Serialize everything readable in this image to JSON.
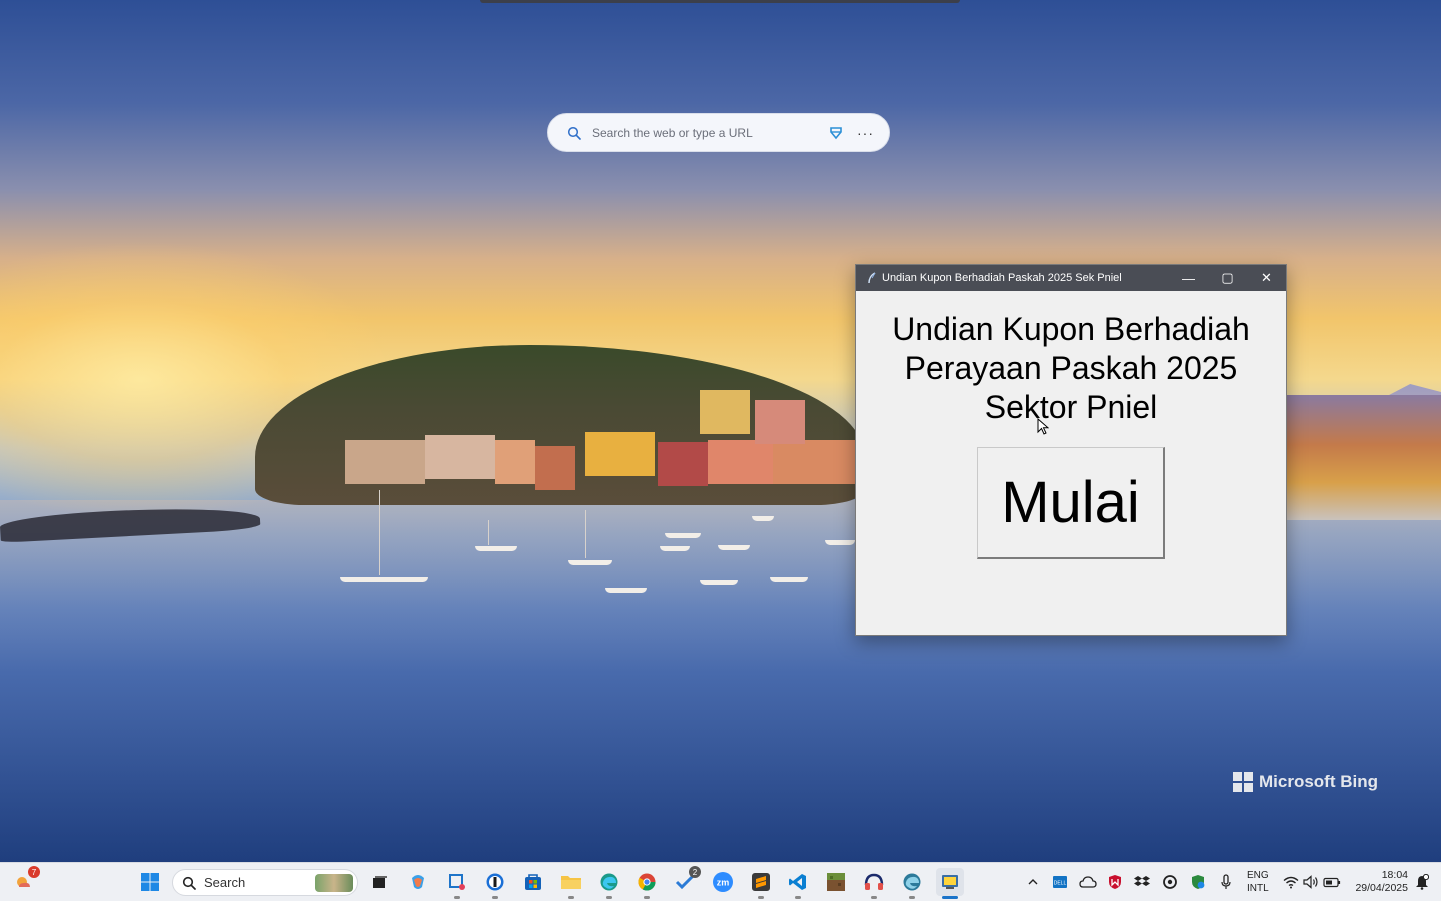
{
  "browser": {
    "search_placeholder": "Search the web or type a URL",
    "more_glyph": "···"
  },
  "wallpaper": {
    "brand": "Microsoft Bing"
  },
  "app_window": {
    "title": "Undian Kupon Berhadiah Paskah 2025 Sek Pniel",
    "heading_lines": [
      "Undian Kupon Berhadiah",
      "Perayaan Paskah 2025",
      "Sektor Pniel"
    ],
    "start_button": "Mulai",
    "controls": {
      "minimize": "—",
      "maximize": "▢",
      "close": "✕"
    }
  },
  "taskbar": {
    "widgets_badge": "7",
    "search_label": "Search",
    "todo_badge": "2",
    "apps": [
      "windows-start",
      "task-view",
      "copilot",
      "snipping-tool",
      "1password",
      "microsoft-store",
      "file-explorer",
      "edge",
      "chrome",
      "todo",
      "zoom",
      "sublime-text",
      "vscode",
      "minecraft",
      "audio-app",
      "edge-dev",
      "python-app"
    ],
    "tray": {
      "language_line1": "ENG",
      "language_line2": "INTL",
      "time": "18:04",
      "date": "29/04/2025"
    }
  },
  "colors": {
    "titlebar": "#4a4d55",
    "window_bg": "#f0f0f0",
    "taskbar_bg": "#eef0f4",
    "accent": "#1a73c9"
  }
}
